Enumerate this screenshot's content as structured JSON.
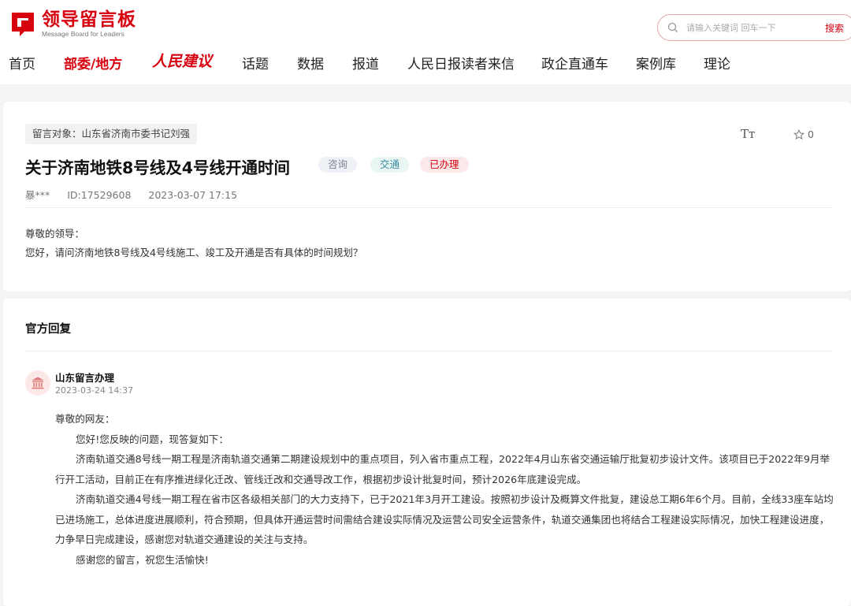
{
  "brand": {
    "title": "领导留言板",
    "subtitle": "Message Board for Leaders",
    "color": "#d7000f"
  },
  "search": {
    "placeholder": "请输入关键词 回车一下",
    "button_label": "搜索",
    "icon": "search-icon"
  },
  "nav": {
    "items": [
      {
        "label": "首页",
        "active": false
      },
      {
        "label": "部委/地方",
        "active": true
      },
      {
        "label": "人民建议",
        "active": false
      },
      {
        "label": "话题",
        "active": false
      },
      {
        "label": "数据",
        "active": false
      },
      {
        "label": "报道",
        "active": false
      },
      {
        "label": "人民日报读者来信",
        "active": false
      },
      {
        "label": "政企直通车",
        "active": false
      },
      {
        "label": "案例库",
        "active": false
      },
      {
        "label": "理论",
        "active": false
      }
    ]
  },
  "message": {
    "target": "留言对象：山东省济南市委书记刘强",
    "font_size_icon": "Tт",
    "favorite_count": "0",
    "title": "关于济南地铁8号线及4号线开通时间",
    "tags": {
      "type": "咨询",
      "category": "交通",
      "status": "已办理"
    },
    "author": "暴***",
    "id": "ID:17529608",
    "datetime": "2023-03-07 17:15",
    "greeting": "尊敬的领导：",
    "content": "您好，请问济南地铁8号线及4号线施工、竣工及开通是否有具体的时间规划？"
  },
  "reply": {
    "header": "官方回复",
    "replier": "山东留言办理",
    "time": "2023-03-24 14:37",
    "greeting": "尊敬的网友：",
    "paragraphs": [
      "您好!您反映的问题，现答复如下：",
      "济南轨道交通8号线一期工程是济南轨道交通第二期建设规划中的重点项目，列入省市重点工程，2022年4月山东省交通运输厅批复初步设计文件。该项目已于2022年9月举行开工活动，目前正在有序推进绿化迁改、管线迁改和交通导改工作，根据初步设计批复时间，预计2026年底建设完成。",
      "济南轨道交通4号线一期工程在省市区各级相关部门的大力支持下，已于2021年3月开工建设。按照初步设计及概算文件批复，建设总工期6年6个月。目前，全线33座车站均已进场施工，总体进度进展顺利，符合预期，但具体开通运营时间需结合建设实际情况及运营公司安全运营条件，轨道交通集团也将结合工程建设实际情况，加快工程建设进度，力争早日完成建设，感谢您对轨道交通建设的关注与支持。",
      "感谢您的留言，祝您生活愉快!"
    ]
  }
}
